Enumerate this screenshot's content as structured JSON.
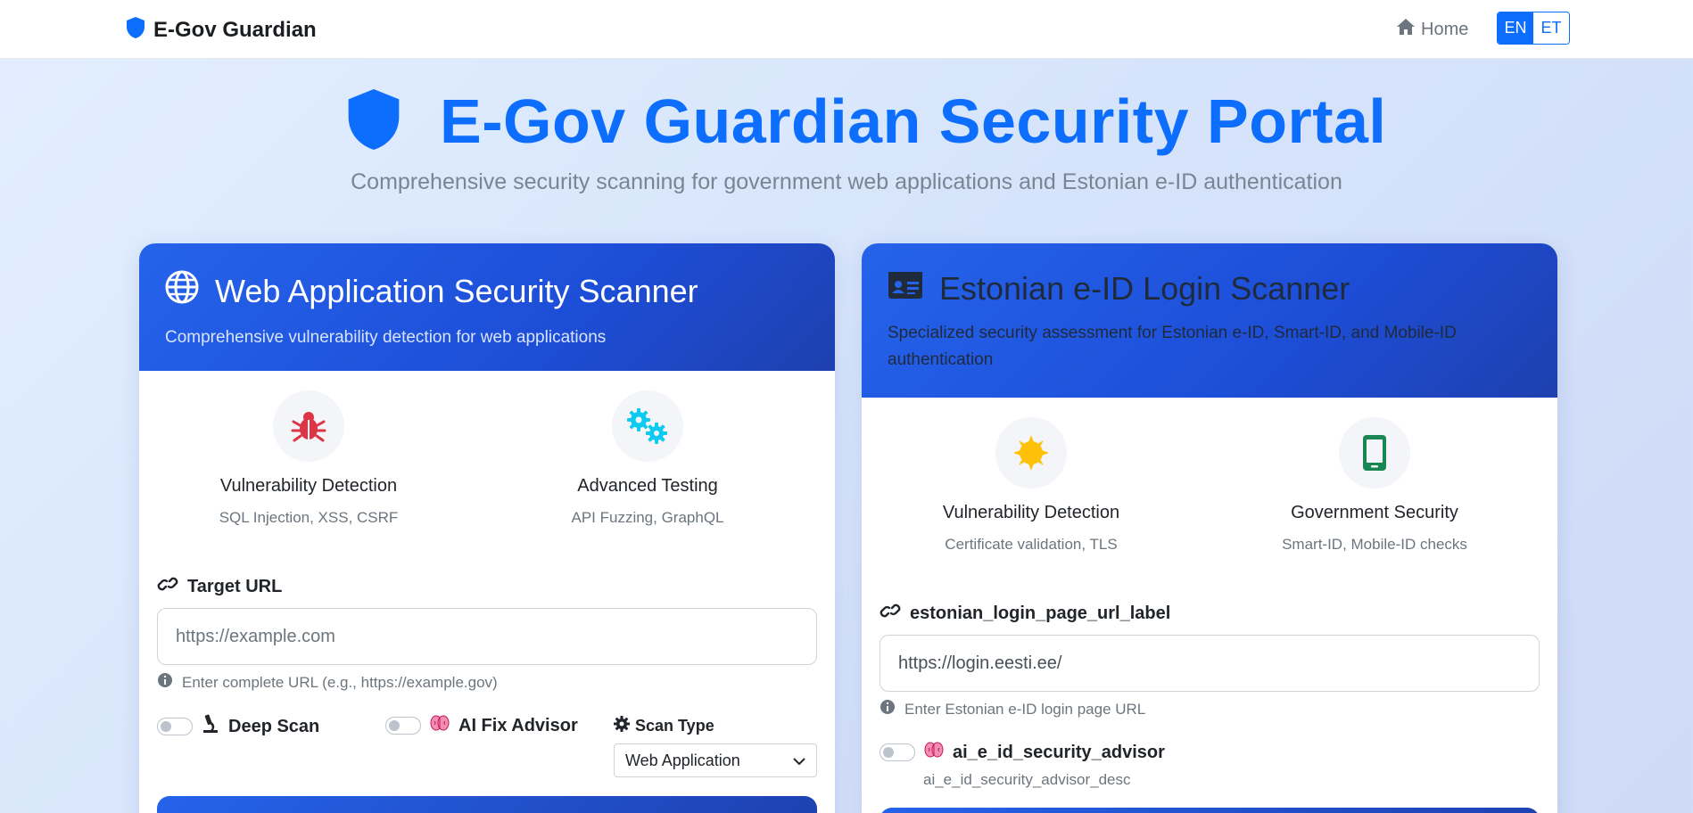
{
  "navbar": {
    "brand": "E-Gov Guardian",
    "home_label": "Home",
    "lang_en": "EN",
    "lang_et": "ET"
  },
  "hero": {
    "title": "E-Gov Guardian Security Portal",
    "subtitle": "Comprehensive security scanning for government web applications and Estonian e-ID authentication"
  },
  "web_scanner": {
    "title": "Web Application Security Scanner",
    "subtitle": "Comprehensive vulnerability detection for web applications",
    "features": [
      {
        "title": "Vulnerability Detection",
        "desc": "SQL Injection, XSS, CSRF",
        "icon": "bug-icon"
      },
      {
        "title": "Advanced Testing",
        "desc": "API Fuzzing, GraphQL",
        "icon": "cogs-icon"
      }
    ],
    "target_url_label": "Target URL",
    "target_url_placeholder": "https://example.com",
    "target_url_help": "Enter complete URL (e.g., https://example.gov)",
    "deep_scan_label": "Deep Scan",
    "ai_fix_label": "AI Fix Advisor",
    "scan_type_label": "Scan Type",
    "scan_type_value": "Web Application"
  },
  "eid_scanner": {
    "title": "Estonian e-ID Login Scanner",
    "subtitle": "Specialized security assessment for Estonian e-ID, Smart-ID, and Mobile-ID authentication",
    "features": [
      {
        "title": "Vulnerability Detection",
        "desc": "Certificate validation, TLS",
        "icon": "certificate-icon"
      },
      {
        "title": "Government Security",
        "desc": "Smart-ID, Mobile-ID checks",
        "icon": "mobile-icon"
      }
    ],
    "login_url_label": "estonian_login_page_url_label",
    "login_url_value": "https://login.eesti.ee/",
    "login_url_help": "Enter Estonian e-ID login page URL",
    "advisor_label": "ai_e_id_security_advisor",
    "advisor_desc": "ai_e_id_security_advisor_desc"
  },
  "colors": {
    "primary": "#0d6efd",
    "header_gradient_start": "#2563eb",
    "header_gradient_end": "#1e40af",
    "bug_red": "#dc3545",
    "cogs_cyan": "#0dcaf0",
    "cert_yellow": "#ffc107",
    "mobile_green": "#198754"
  }
}
